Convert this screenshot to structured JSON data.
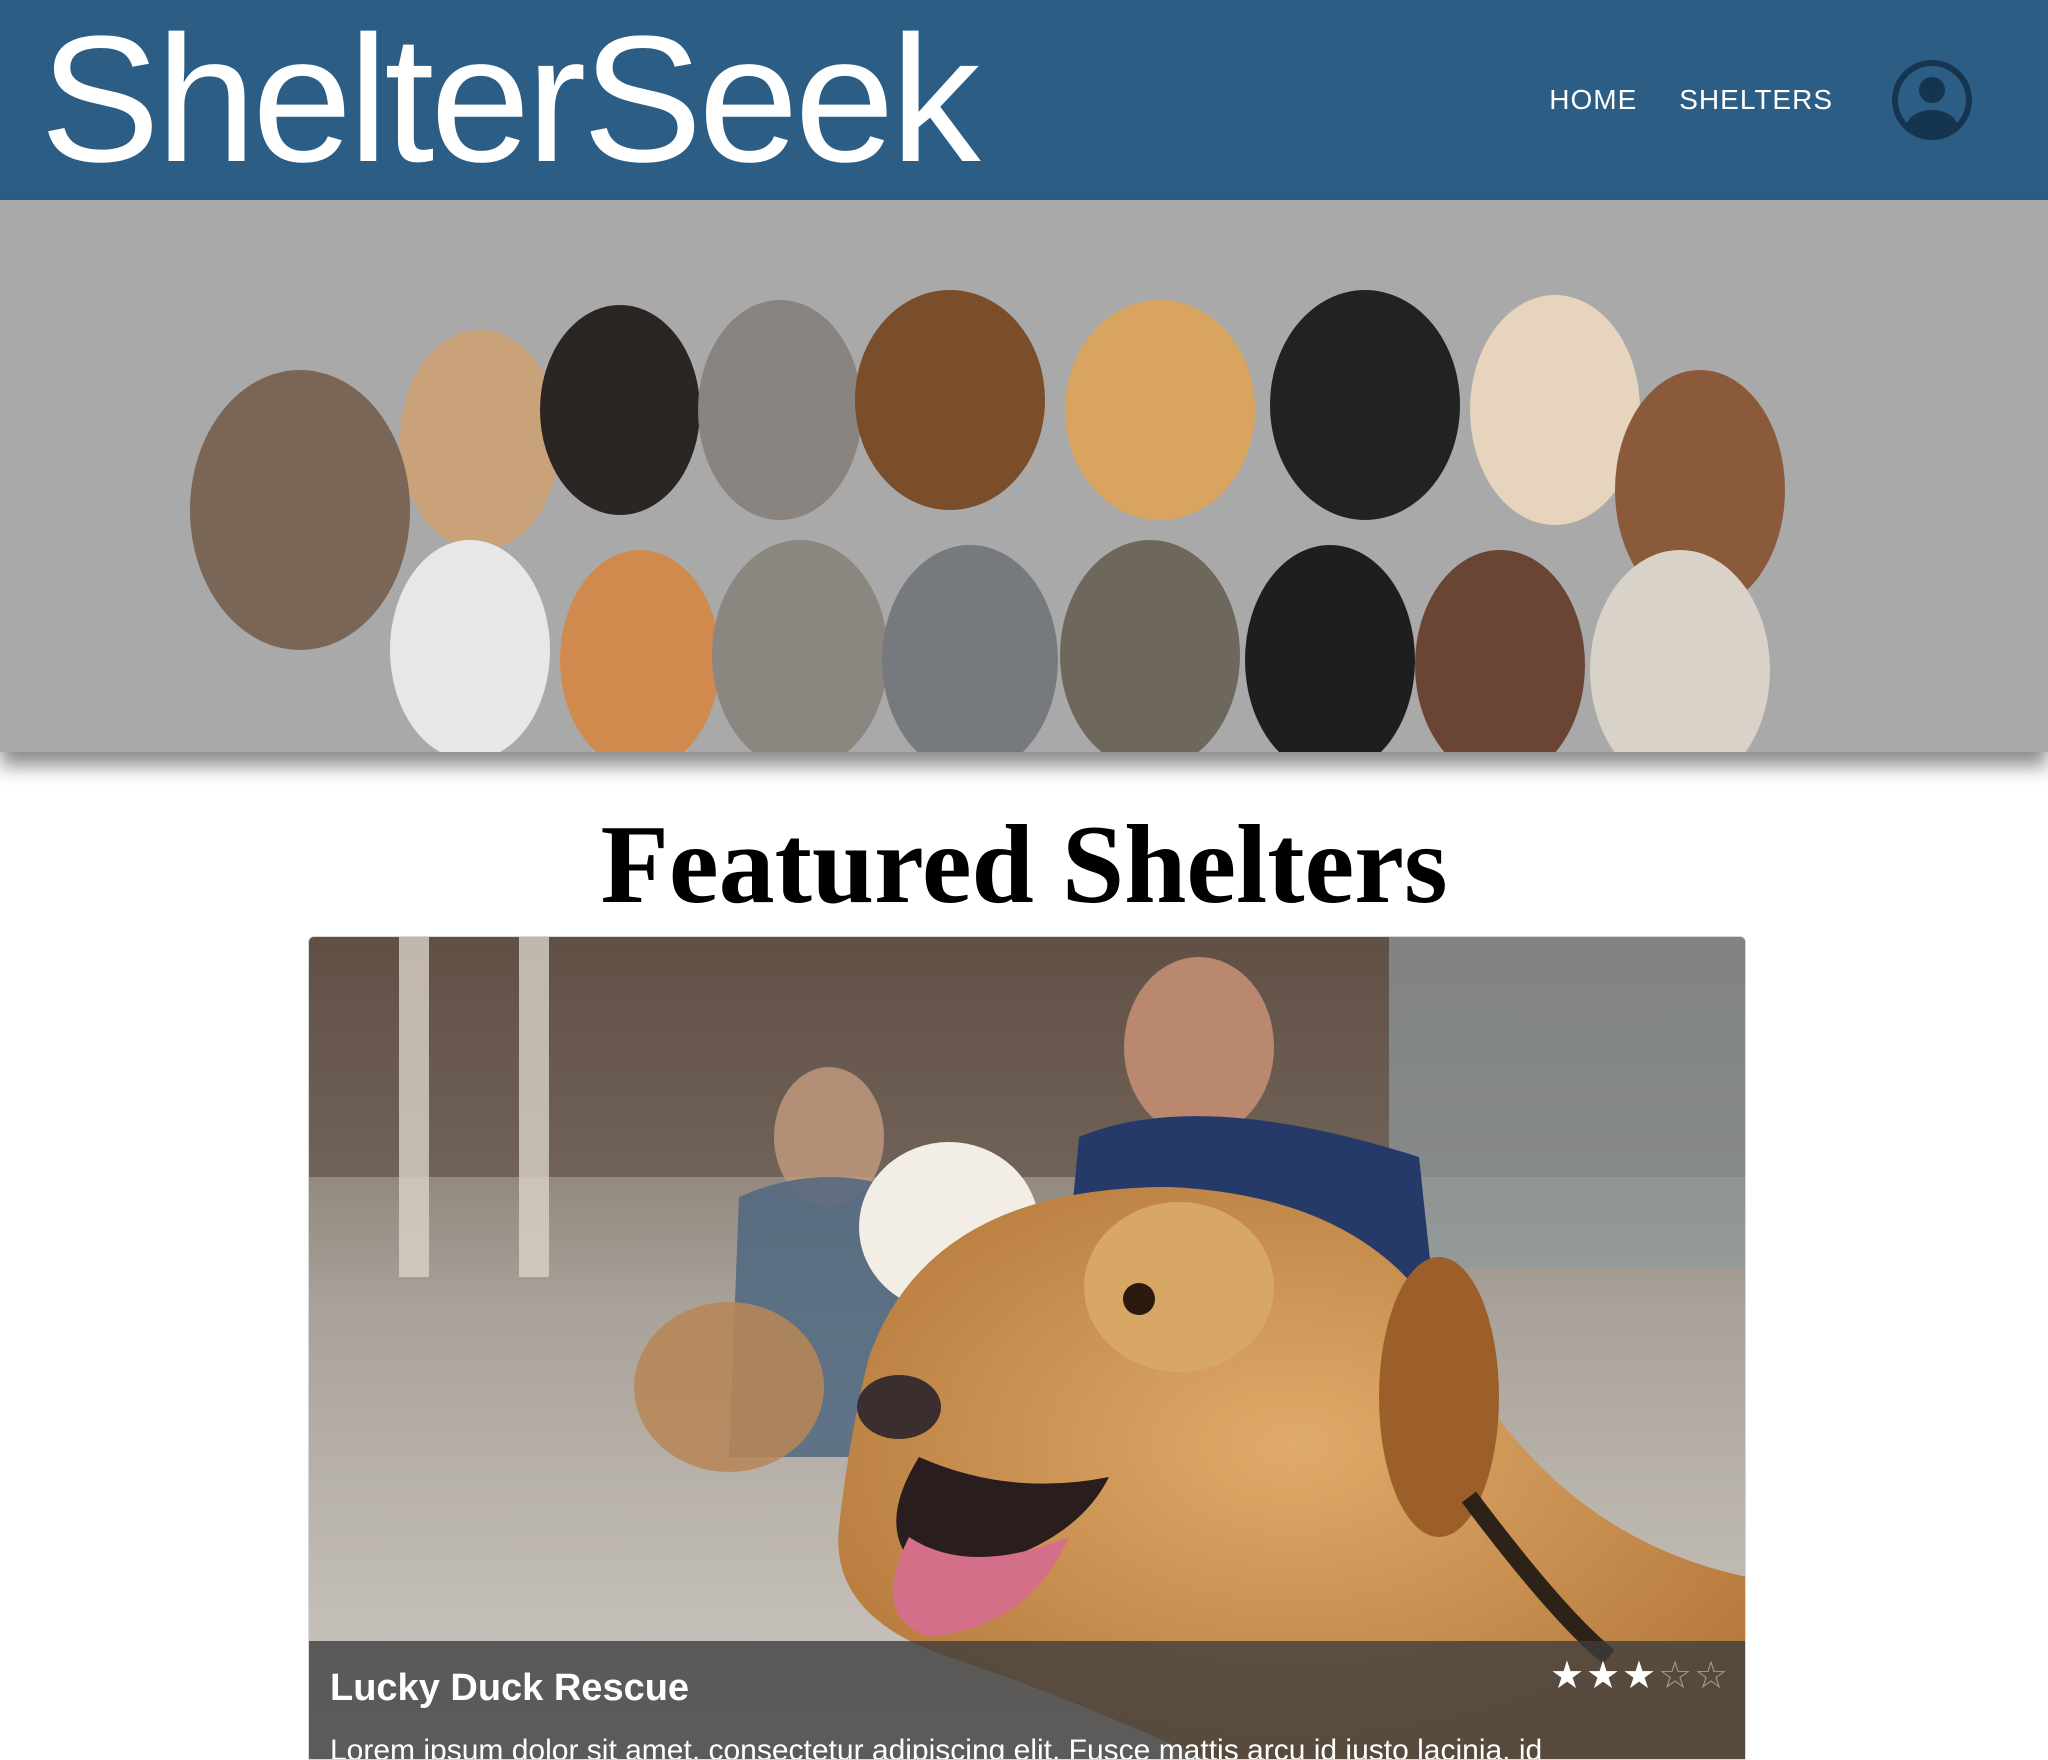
{
  "header": {
    "brand": "ShelterSeek",
    "nav": [
      {
        "label": "HOME"
      },
      {
        "label": "SHELTERS"
      }
    ],
    "avatar_icon": "user-circle-icon"
  },
  "hero": {
    "image": "group of dogs and cats photo",
    "background": "#a9a9a9"
  },
  "featured": {
    "title": "Featured Shelters",
    "cards": [
      {
        "name": "Lucky Duck Rescue",
        "description": "Lorem ipsum dolor sit amet, consectetur adipiscing elit. Fusce mattis arcu id justo lacinia, id",
        "rating": 3,
        "rating_max": 5,
        "image": "dog with owners on steps photo"
      }
    ]
  },
  "colors": {
    "navbar": "#2c5d84",
    "caption_overlay": "rgba(60,60,60,0.78)"
  }
}
